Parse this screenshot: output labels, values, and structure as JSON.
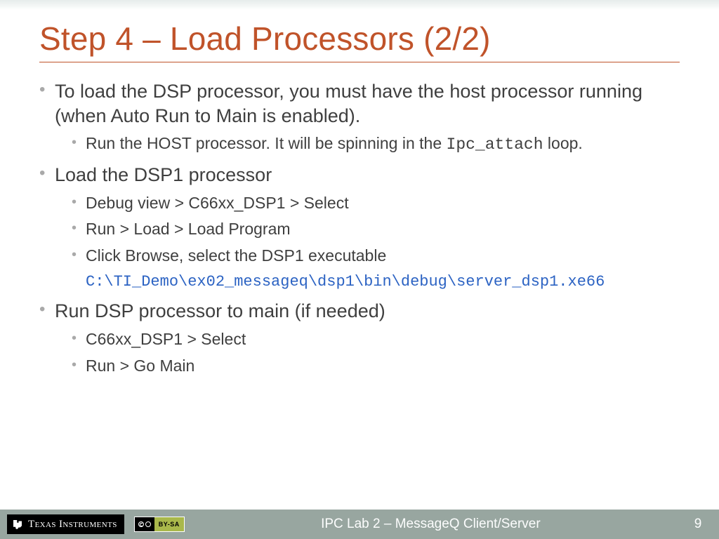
{
  "title": "Step 4 – Load Processors (2/2)",
  "bullets": {
    "b1": {
      "text_a": "To load the DSP processor, you must have the host processor running (when Auto Run to Main is enabled).",
      "s1_a": "Run the HOST processor. It will be spinning in the ",
      "s1_code": "Ipc_attach",
      "s1_b": " loop."
    },
    "b2": {
      "text": "Load the DSP1 processor",
      "s1": "Debug view > C66xx_DSP1 > Select",
      "s2": "Run > Load > Load Program",
      "s3": "Click Browse, select the DSP1 executable",
      "path": "C:\\TI_Demo\\ex02_messageq\\dsp1\\bin\\debug\\server_dsp1.xe66"
    },
    "b3": {
      "text": "Run DSP processor to main (if needed)",
      "s1": "C66xx_DSP1 > Select",
      "s2": "Run > Go Main"
    }
  },
  "footer": {
    "logo_text": "Texas Instruments",
    "cc_label": "BY-SA",
    "lab_title": "IPC Lab 2 – MessageQ Client/Server",
    "page": "9"
  }
}
